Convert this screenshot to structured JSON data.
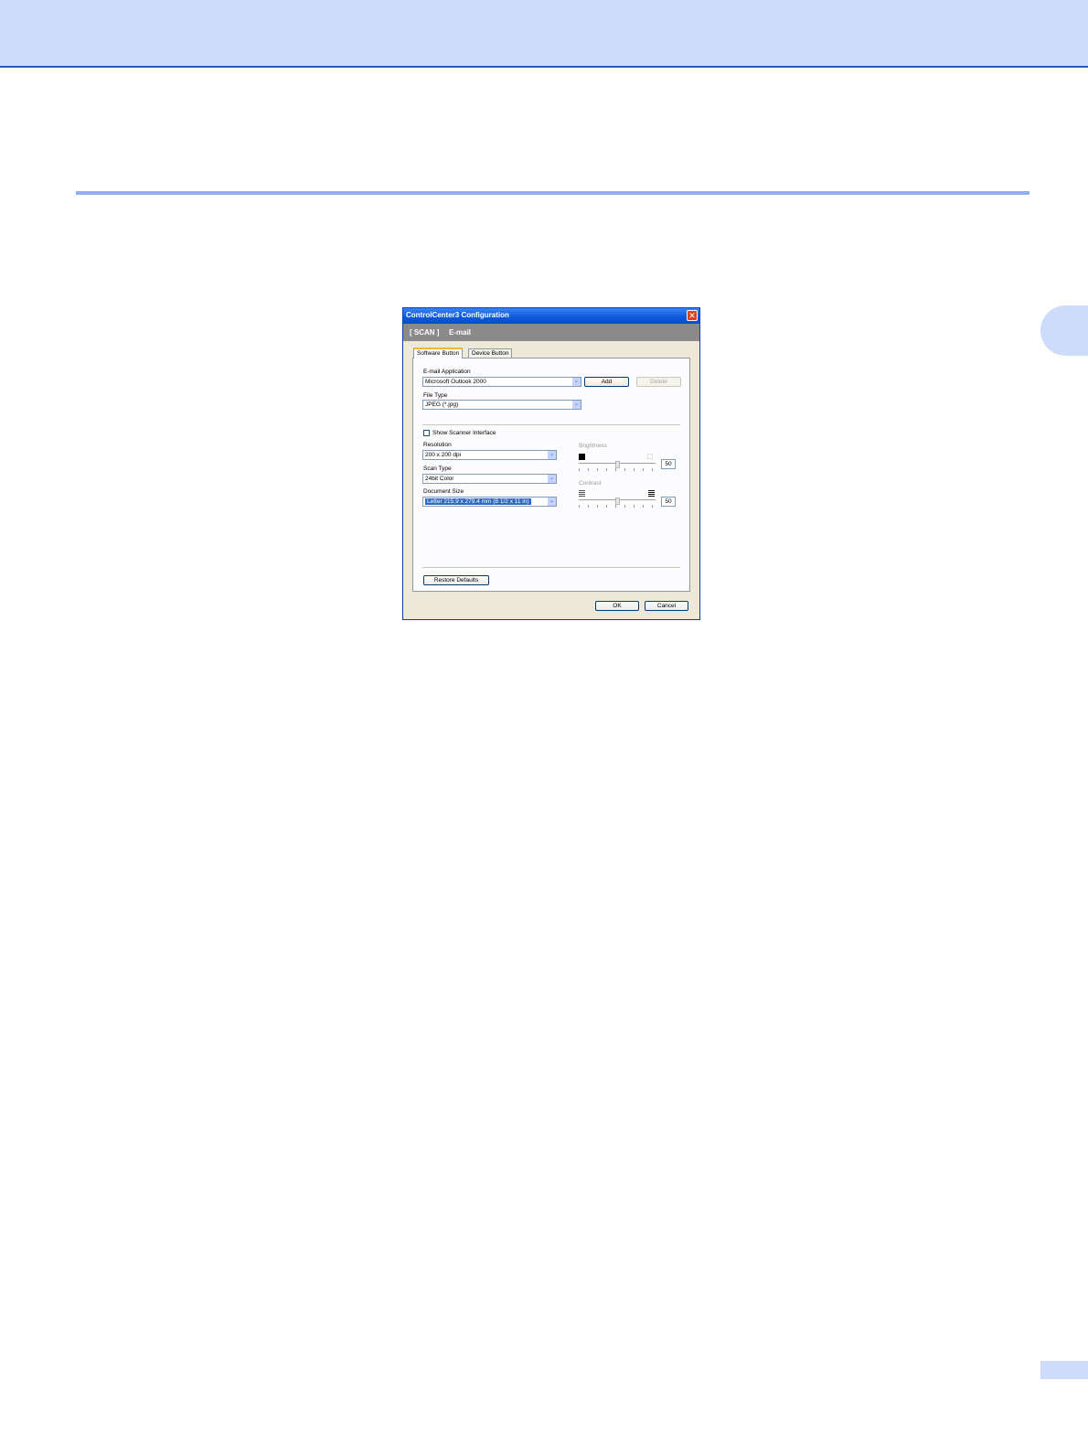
{
  "dialog": {
    "title": "ControlCenter3 Configuration",
    "close_glyph": "✕",
    "header": {
      "section": "[ SCAN ]",
      "item": "E-mail"
    },
    "tabs": [
      {
        "label": "Software Button",
        "active": true
      },
      {
        "label": "Device Button",
        "active": false
      }
    ],
    "email_app": {
      "label": "E-mail Application",
      "value": "Microsoft Outlook 2000",
      "add_label": "Add",
      "delete_label": "Delete"
    },
    "file_type": {
      "label": "File Type",
      "value": "JPEG (*.jpg)"
    },
    "show_scanner": {
      "label": "Show Scanner Interface",
      "checked": false
    },
    "resolution": {
      "label": "Resolution",
      "value": "200 x 200 dpi"
    },
    "scan_type": {
      "label": "Scan Type",
      "value": "24bit Color"
    },
    "document_size": {
      "label": "Document Size",
      "value": "Letter 215.9 x 279.4 mm (8 1/2 x 11 in)"
    },
    "brightness": {
      "label": "Brightness",
      "value": "50",
      "level_fraction": 0.5
    },
    "contrast": {
      "label": "Contrast",
      "value": "50",
      "level_fraction": 0.5
    },
    "restore_label": "Restore Defaults",
    "ok_label": "OK",
    "cancel_label": "Cancel",
    "dropdown_glyph": "⌄"
  },
  "colors": {
    "band": "#cddcfb",
    "rule": "#93aeef",
    "titlebar": "#0b57d8",
    "header_bar": "#8a8a8a",
    "selection": "#316ac5"
  }
}
